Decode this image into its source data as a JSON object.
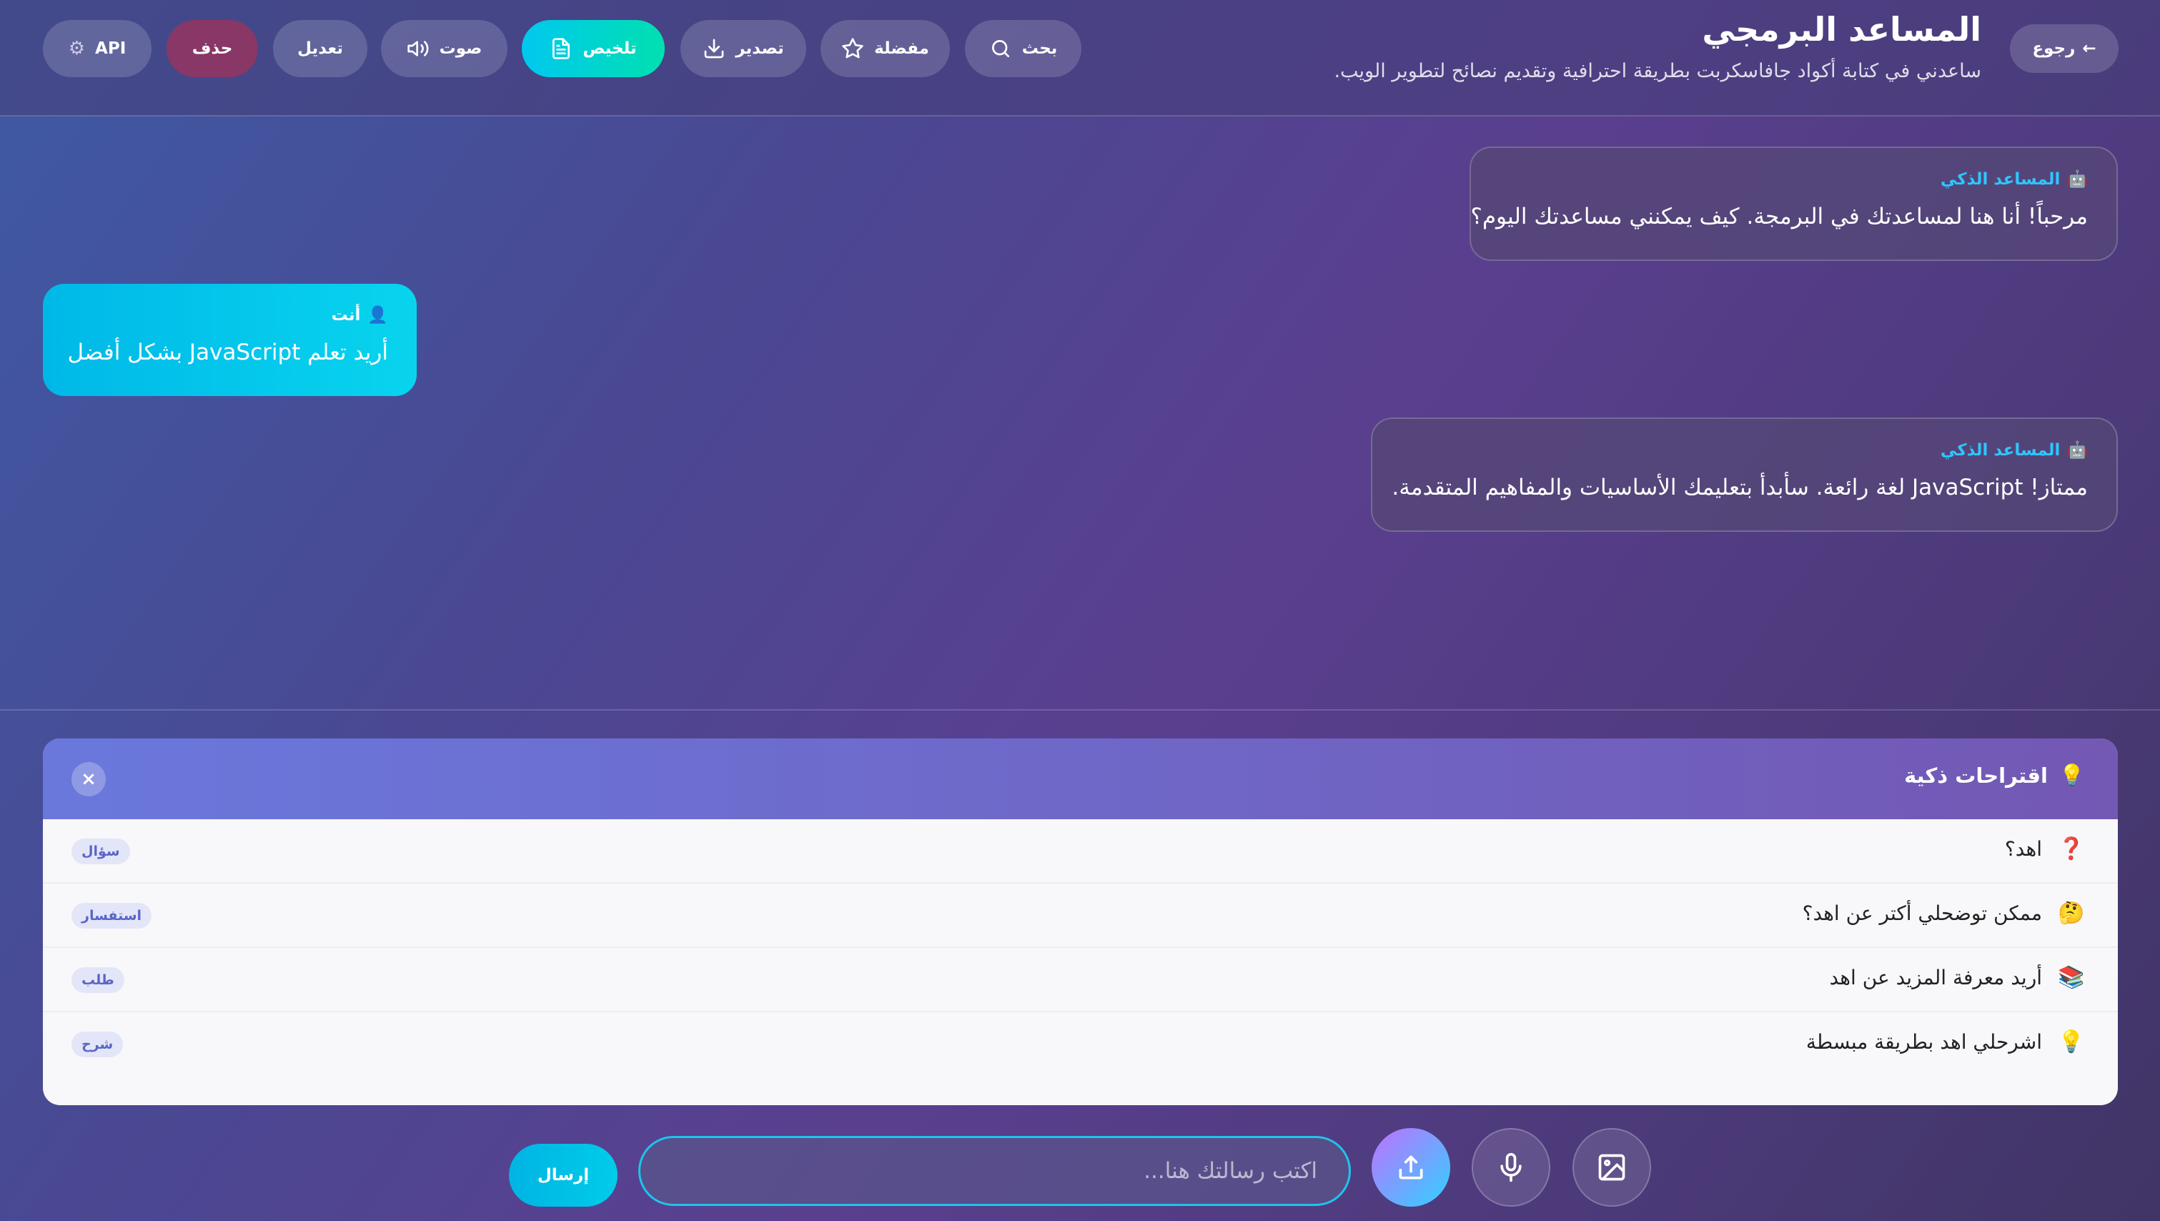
{
  "header": {
    "title": "المساعد البرمجي",
    "subtitle": "ساعدني في كتابة أكواد جافاسكربت بطريقة احترافية وتقديم نصائح لتطوير الويب.",
    "back_label": "رجوع",
    "toolbar": {
      "api": "API",
      "delete": "حذف",
      "edit": "تعديل",
      "voice": "صوت",
      "summarize": "تلخيص",
      "export": "تصدير",
      "favorite": "مفضلة",
      "search": "بحث"
    }
  },
  "messages": [
    {
      "sender": "المساعد الذكي",
      "role": "assistant",
      "text": "مرحباً! أنا هنا لمساعدتك في البرمجة. كيف يمكنني مساعدتك اليوم؟"
    },
    {
      "sender": "أنت",
      "role": "user",
      "text": "أريد تعلم JavaScript بشكل أفضل"
    },
    {
      "sender": "المساعد الذكي",
      "role": "assistant",
      "text": "ممتاز! JavaScript لغة رائعة. سأبدأ بتعليمك الأساسيات والمفاهيم المتقدمة."
    }
  ],
  "suggestions": {
    "title": "اقتراحات ذكية",
    "close": "×",
    "items": [
      {
        "icon": "❓",
        "text": "اهد؟",
        "tag": "سؤال"
      },
      {
        "icon": "🤔",
        "text": "ممكن توضحلي أكتر عن اهد؟",
        "tag": "استفسار"
      },
      {
        "icon": "📚",
        "text": "أريد معرفة المزيد عن اهد",
        "tag": "طلب"
      },
      {
        "icon": "💡",
        "text": "اشرحلي اهد بطريقة مبسطة",
        "tag": "شرح"
      }
    ]
  },
  "composer": {
    "placeholder": "اكتب رسالتك هنا...",
    "send_label": "إرسال"
  },
  "colors": {
    "accent": "#00c8f0",
    "danger": "#a0325a",
    "bot_name": "#2ec6ff"
  }
}
